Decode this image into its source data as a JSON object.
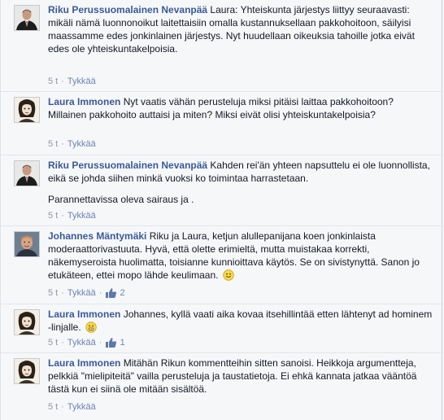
{
  "comments": [
    {
      "author": "Riku Perussuomalainen Nevanpää",
      "text": "Laura: Yhteiskunta järjestys liittyy seuraavasti: mikäli nämä luonnonoikut laitettaisiin omalla kustannuksellaan pakkohoitoon, säilyisi maassamme edes jonkinlainen järjestys. Nyt huudellaan oikeuksia tahoille jotka eivät edes ole yhteiskuntakelpoisia.",
      "time": "5 t",
      "like_label": "Tykkää",
      "avatar": "man-suit-avatar"
    },
    {
      "author": "Laura Immonen",
      "text": "Nyt vaatis vähän perusteluja miksi pitäisi laittaa pakkohoitoon? Millainen pakkohoito auttaisi ja miten? Miksi eivät olisi yhteiskuntakelpoisia?",
      "time": "5 t",
      "like_label": "Tykkää",
      "avatar": "woman-sketch-avatar"
    },
    {
      "author": "Riku Perussuomalainen Nevanpää",
      "text": "Kahden rei'än yhteen napsuttelu ei ole luonnollista, eikä se johda siihen minkä vuoksi ko toimintaa harrastetaan.",
      "text2": "Parannettavissa oleva sairaus ja .",
      "time": "5 t",
      "like_label": "Tykkää",
      "avatar": "man-suit-avatar"
    },
    {
      "author": "Johannes Mäntymäki",
      "text": "Riku ja Laura, ketjun alullepanijana koen jonkinlaista moderaattorivastuuta. Hyvä, että olette erimieltä, mutta muistakaa korrekti, näkemyseroista huolimatta, toisianne kunnioittava käytös. Se on sivistynyttä. Sanon jo etukäteen, ettei mopo lähde keulimaan.",
      "emoticon": "smile-emoticon",
      "time": "5 t",
      "like_label": "Tykkää",
      "like_count": "2",
      "avatar": "man-photo-avatar"
    },
    {
      "author": "Laura Immonen",
      "text": "Johannes, kyllä vaati aika kovaa itsehillintää etten lähtenyt ad hominem -linjalle.",
      "emoticon": "grimace-emoticon",
      "time": "5 t",
      "like_label": "Tykkää",
      "like_count": "1",
      "avatar": "woman-sketch-avatar"
    },
    {
      "author": "Laura Immonen",
      "text": "Mitähän Rikun kommentteihin sitten sanoisi. Heikkoja argumentteja, pelkkiä \"mielipiteitä\" vailla perusteluja ja taustatietoja. Ei ehkä kannata jatkaa vääntöä tästä kun ei siinä ole mitään sisältöä.",
      "time": "5 t",
      "like_label": "Tykkää",
      "avatar": "woman-sketch-avatar"
    }
  ],
  "colors": {
    "author": "#3b5998",
    "meta": "#9197a3",
    "background": "#f6f7f9"
  }
}
